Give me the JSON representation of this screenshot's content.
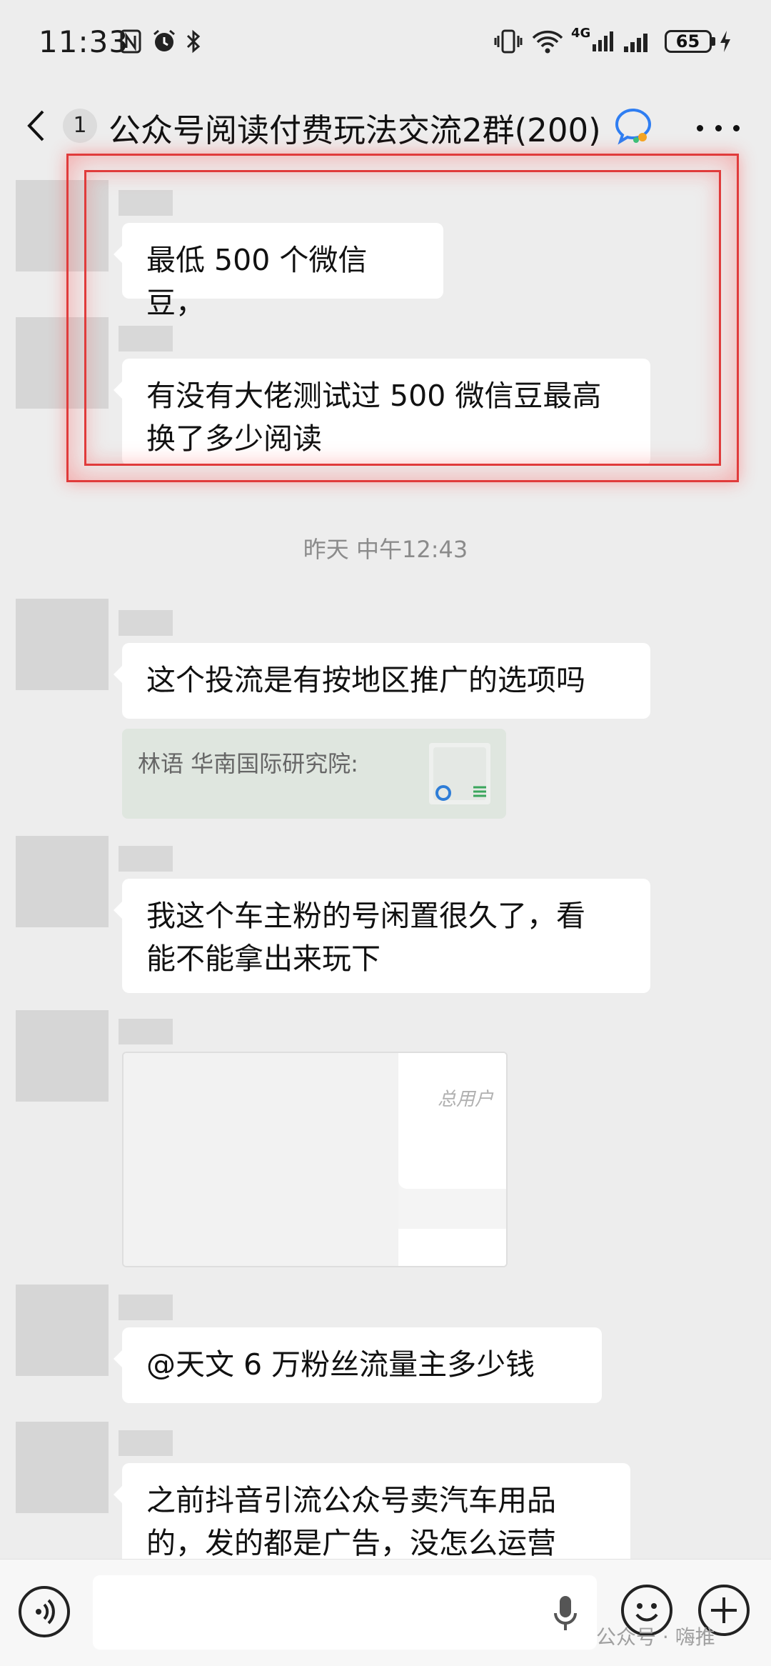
{
  "status_bar": {
    "time": "11:33",
    "battery": "65",
    "network": "4G",
    "icons": [
      "nfc-icon",
      "alarm-icon",
      "bluetooth-icon",
      "vibrate-icon",
      "wifi-icon",
      "signal-icon",
      "signal-icon",
      "battery-icon",
      "charging-icon"
    ]
  },
  "header": {
    "unread_count": "1",
    "title": "公众号阅读付费玩法交流2群(200)",
    "icons": [
      "back-icon",
      "chat-bubble-icon",
      "more-icon"
    ]
  },
  "messages": [
    {
      "text": "最低 500 个微信豆，"
    },
    {
      "text_line1": "有没有大佬测试过 500 微信豆最高",
      "text_line2": "换了多少阅读"
    },
    {
      "timestamp": "昨天 中午12:43"
    },
    {
      "text": "这个投流是有按地区推广的选项吗",
      "quote": "林语  华南国际研究院:"
    },
    {
      "text_line1": "我这个车主粉的号闲置很久了，看",
      "text_line2": "能不能拿出来玩下"
    },
    {
      "image_caption": "总用户"
    },
    {
      "text": "@天文  6 万粉丝流量主多少钱"
    },
    {
      "text_line1": "之前抖音引流公众号卖汽车用品",
      "text_line2": "的，发的都是广告，没怎么运营"
    }
  ],
  "input_bar": {
    "icons": [
      "voice-icon",
      "mic-icon",
      "emoji-icon",
      "plus-icon"
    ]
  },
  "watermark": "公众号 · 嗨推",
  "colors": {
    "highlight": "#e03b3b",
    "background": "#ededed",
    "bubble": "#ffffff",
    "quote_bg": "#dfe6df"
  }
}
